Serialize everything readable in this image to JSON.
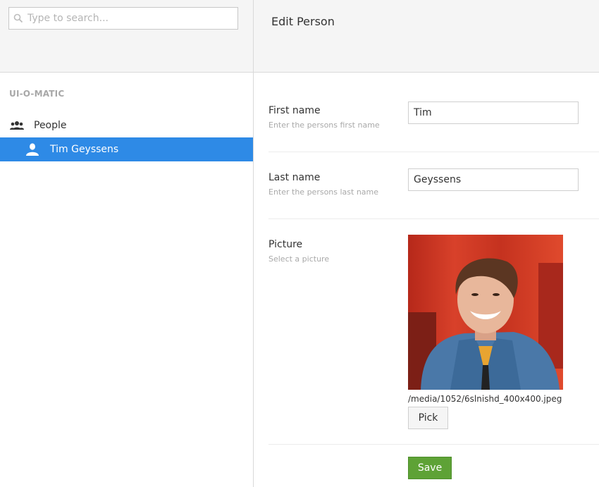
{
  "search": {
    "placeholder": "Type to search..."
  },
  "sidebar": {
    "section_title": "UI-O-MATIC",
    "items": [
      {
        "label": "People",
        "icon": "people-icon"
      },
      {
        "label": "Tim Geyssens",
        "icon": "user-icon",
        "selected": true
      }
    ]
  },
  "header": {
    "title": "Edit Person"
  },
  "form": {
    "first_name": {
      "label": "First name",
      "description": "Enter the persons first name",
      "value": "Tim"
    },
    "last_name": {
      "label": "Last name",
      "description": "Enter the persons last name",
      "value": "Geyssens"
    },
    "picture": {
      "label": "Picture",
      "description": "Select a picture",
      "path": "/media/1052/6slnishd_400x400.jpeg",
      "pick_label": "Pick"
    },
    "save_label": "Save"
  },
  "colors": {
    "selected_bg": "#2e8ae6",
    "save_bg": "#5ea236"
  }
}
